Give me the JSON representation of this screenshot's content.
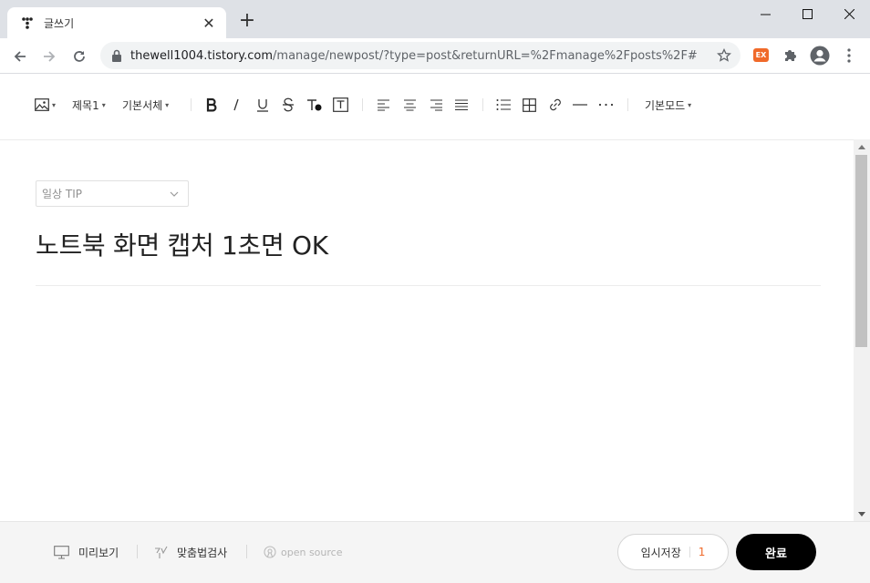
{
  "browser": {
    "tab_title": "글쓰기",
    "url_host": "thewell1004.tistory.com",
    "url_path": "/manage/newpost/?type=post&returnURL=%2Fmanage%2Fposts%2F#",
    "ext_label": "EX"
  },
  "editor_toolbar": {
    "heading_label": "제목1",
    "font_label": "기본서체",
    "mode_label": "기본모드"
  },
  "post": {
    "category": "일상 TIP",
    "title": "노트북 화면 캡처 1초면 OK"
  },
  "footer": {
    "preview_label": "미리보기",
    "spellcheck_label": "맞춤법검사",
    "opensource_label": "open source",
    "draft_label": "임시저장",
    "draft_count": "1",
    "done_label": "완료"
  },
  "colors": {
    "accent": "#f06a2a",
    "done_button": "#000000"
  }
}
